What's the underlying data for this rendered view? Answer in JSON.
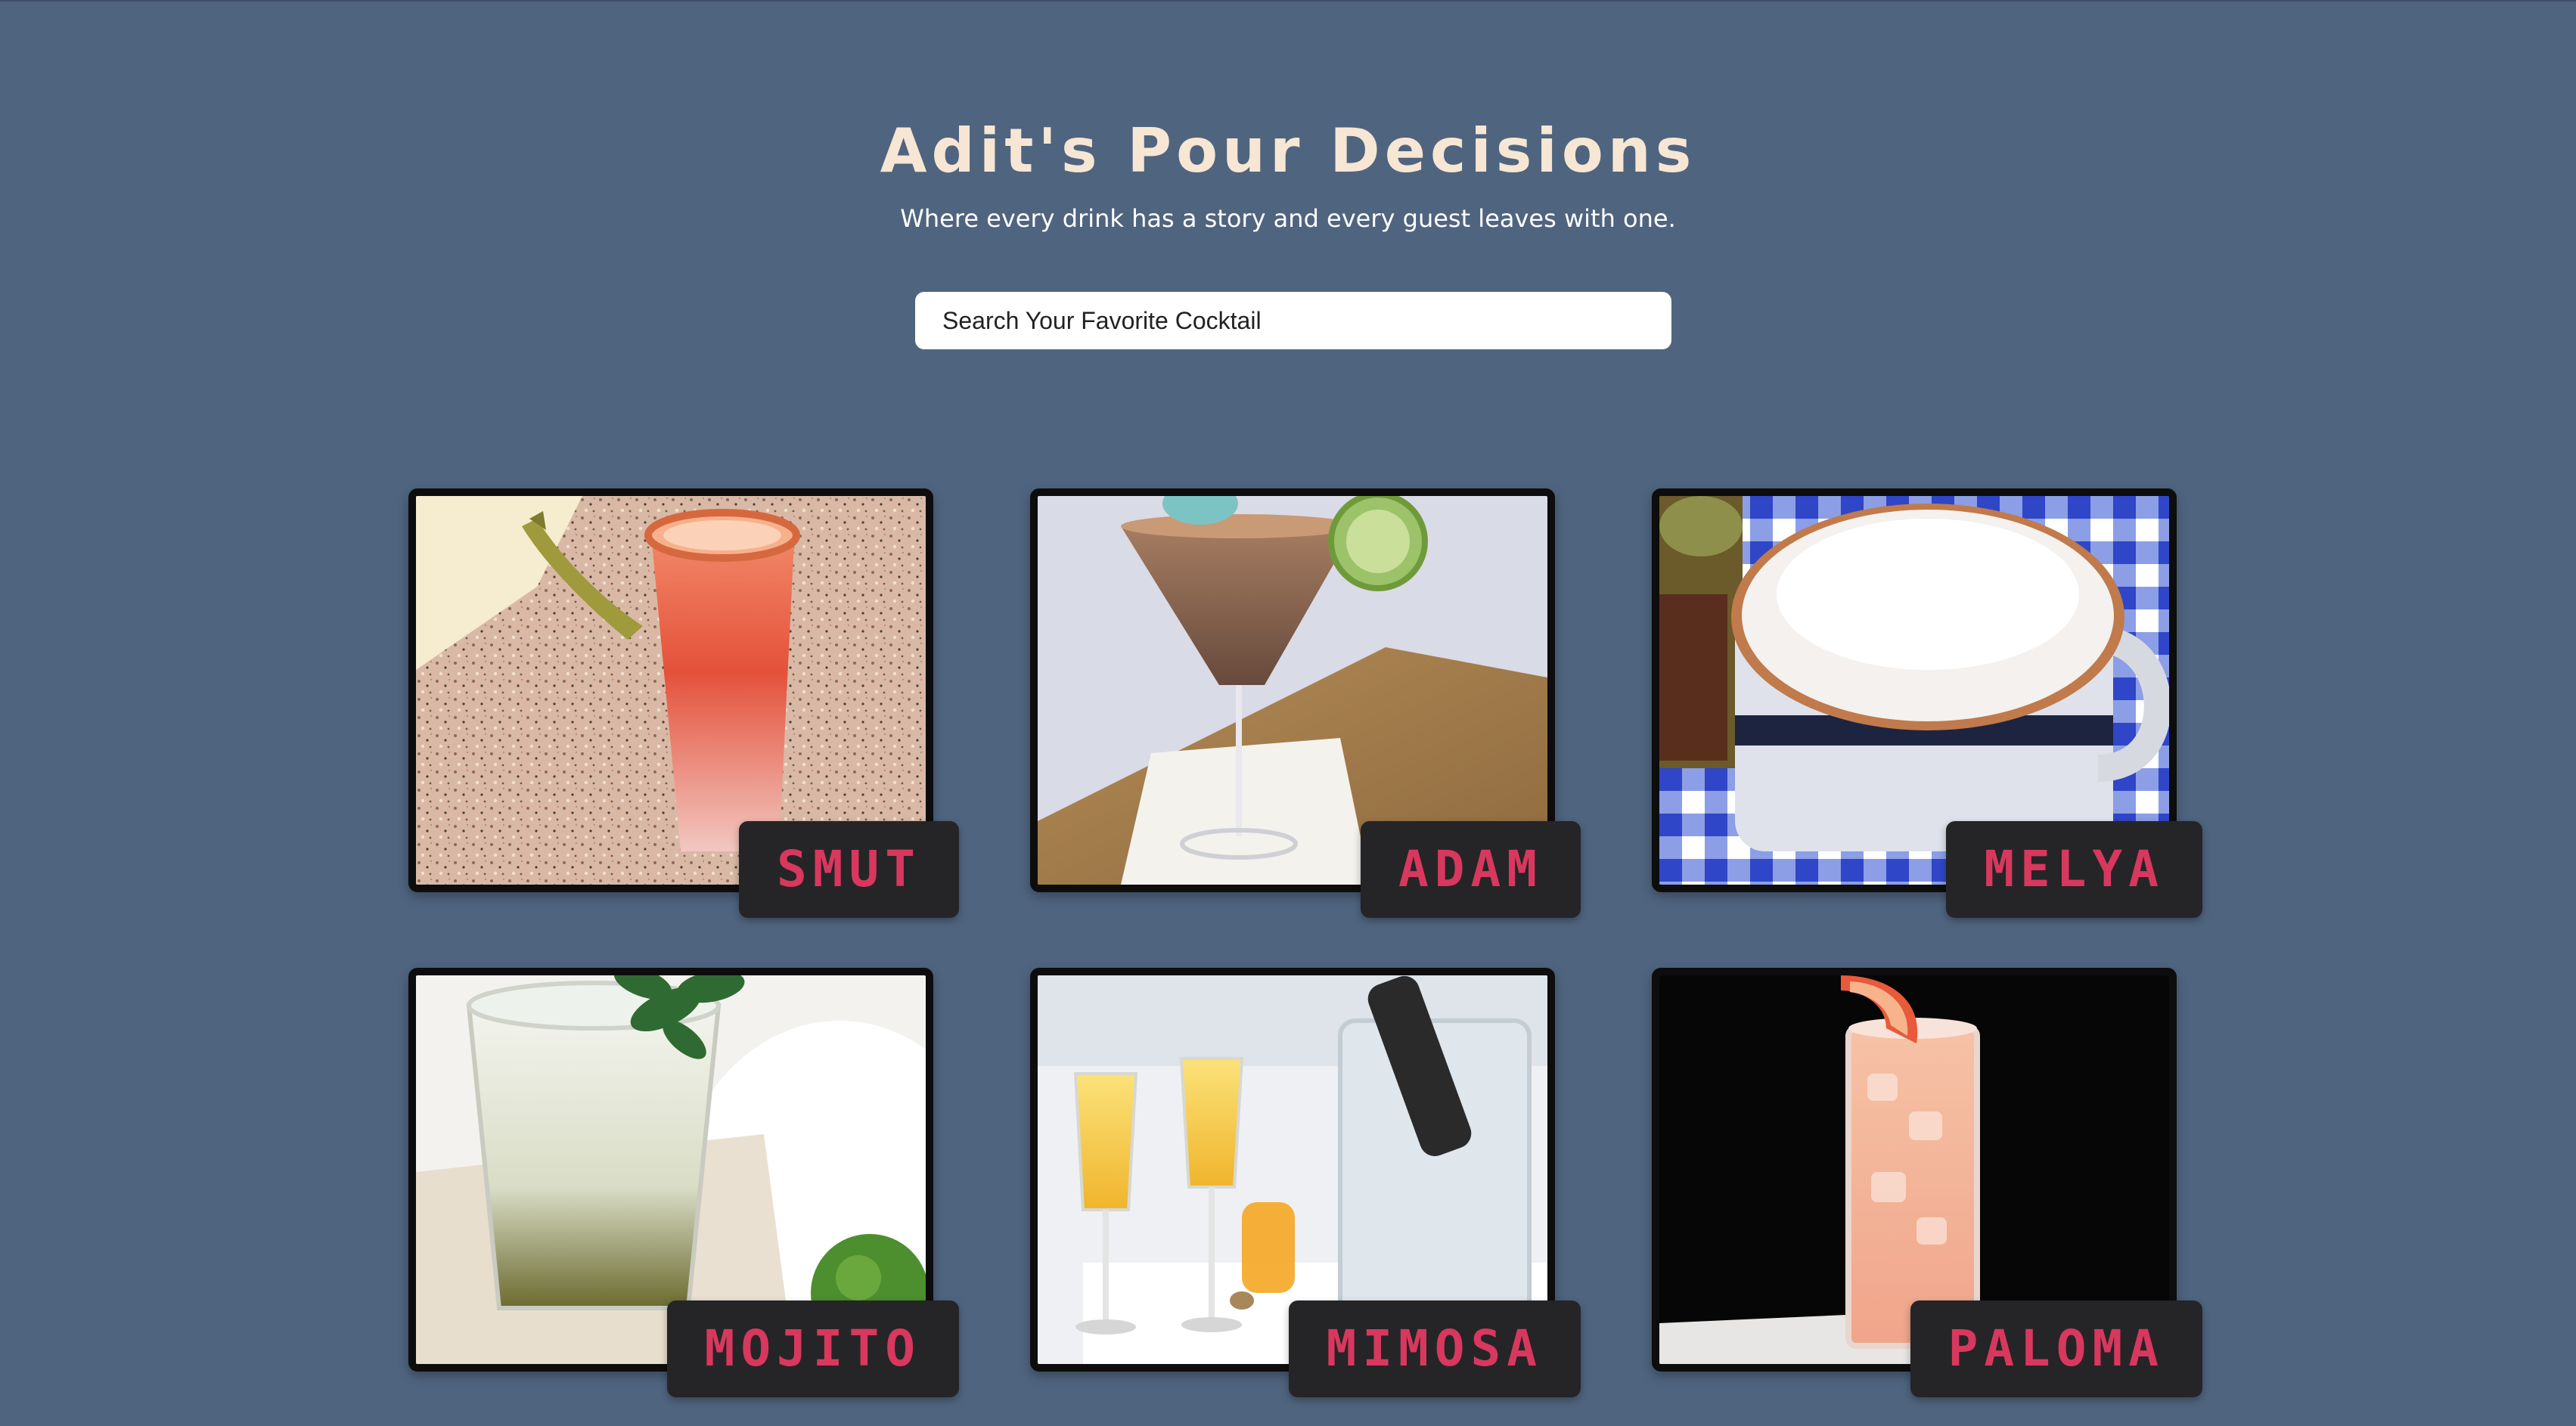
{
  "header": {
    "title": "Adit's Pour Decisions",
    "subtitle": "Where every drink has a story and every guest leaves with one."
  },
  "search": {
    "placeholder": "Search Your Favorite Cocktail"
  },
  "cocktails": [
    {
      "name": "SMUT"
    },
    {
      "name": "ADAM"
    },
    {
      "name": "MELYA"
    },
    {
      "name": "MOJITO"
    },
    {
      "name": "MIMOSA"
    },
    {
      "name": "PALOMA"
    }
  ],
  "colors": {
    "background": "#4f647f",
    "title": "#f6e6d3",
    "tag_background": "#252527",
    "tag_text": "#d8385e"
  }
}
